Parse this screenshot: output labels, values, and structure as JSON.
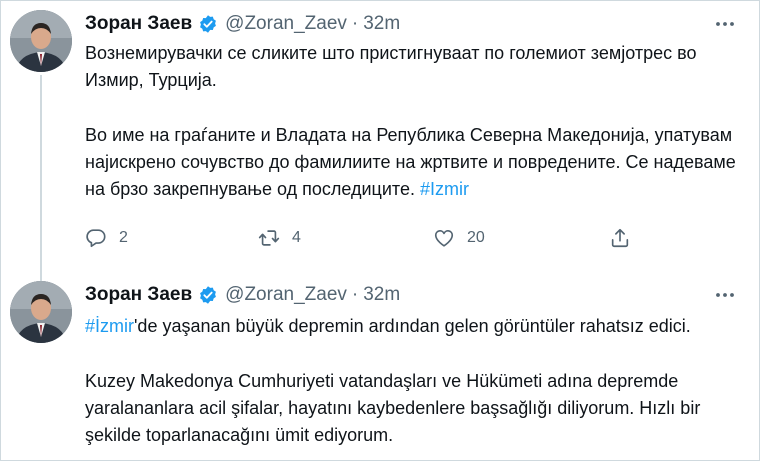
{
  "tweets": [
    {
      "author_name": "Зоран Заев",
      "handle": "@Zoran_Zaev",
      "separator": "·",
      "time": "32m",
      "paragraphs": [
        {
          "text": "Вознемирувачки се сликите што пристигнуваат по големиот земјотрес во Измир, Турција.",
          "hashtag": ""
        },
        {
          "text": "Во име на граѓаните и Владата на Република Северна Македонија, упатувам најискрено сочувство до фамилиите на жртвите и повредените. Се надеваме на брзо закрепнување од последиците. ",
          "hashtag": "#Izmir"
        }
      ],
      "replies": "2",
      "retweets": "4",
      "likes": "20"
    },
    {
      "author_name": "Зоран Заев",
      "handle": "@Zoran_Zaev",
      "separator": "·",
      "time": "32m",
      "hashtag": "#İzmir",
      "paragraphs": [
        "'de yaşanan büyük depremin ardından gelen görüntüler rahatsız edici.",
        "Kuzey Makedonya Cumhuriyeti vatandaşları ve Hükümeti adına depremde yaralananlara acil şifalar, hayatını kaybedenlere başsağlığı diliyorum. Hızlı bir şekilde toparlanacağını ümit ediyorum."
      ]
    }
  ],
  "icons": {
    "verified": "verified-badge-icon",
    "more": "more-dots-icon",
    "reply": "reply-icon",
    "retweet": "retweet-icon",
    "like": "heart-icon",
    "share": "share-icon"
  },
  "colors": {
    "accent": "#1d9bf0",
    "text": "#0f1419",
    "secondary": "#536471",
    "border": "#cfd9de"
  }
}
